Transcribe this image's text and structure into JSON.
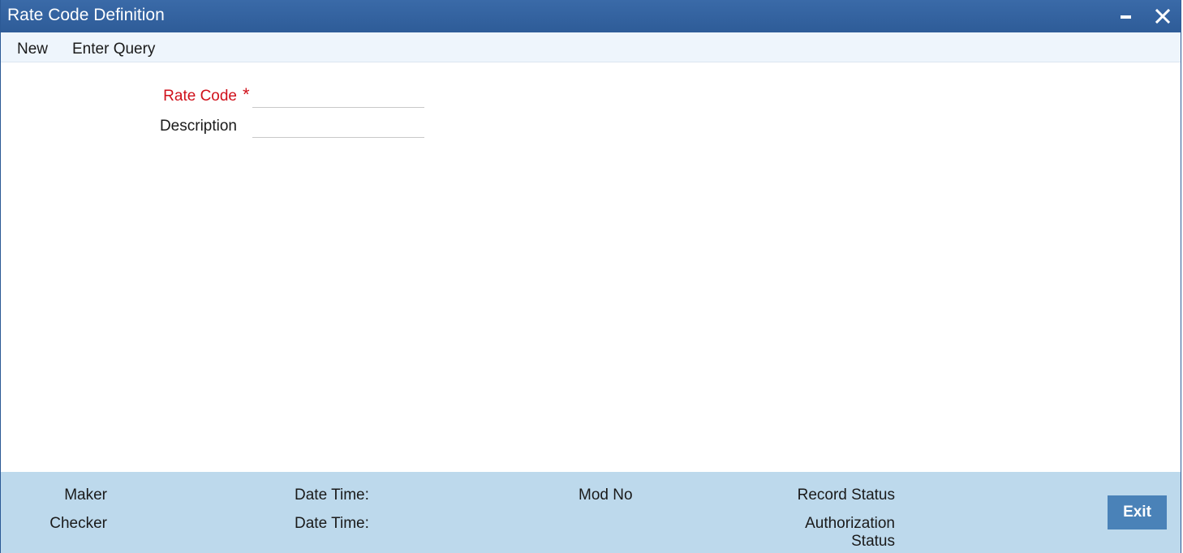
{
  "window": {
    "title": "Rate Code Definition",
    "minimize_icon": "minimize-icon",
    "close_icon": "close-icon"
  },
  "toolbar": {
    "new_label": "New",
    "enter_query_label": "Enter Query"
  },
  "form": {
    "rate_code_label": "Rate Code",
    "required_marker": "*",
    "rate_code_value": "",
    "description_label": "Description",
    "description_value": ""
  },
  "footer": {
    "maker_label": "Maker",
    "checker_label": "Checker",
    "date_time_label_1": "Date Time:",
    "date_time_label_2": "Date Time:",
    "mod_no_label": "Mod No",
    "record_status_label": "Record Status",
    "authorization_status_label": "Authorization Status",
    "exit_label": "Exit"
  },
  "colors": {
    "titlebar": "#2e5c98",
    "toolbar": "#eef5fc",
    "footer": "#bdd9ec",
    "required": "#d0111b",
    "exit_button": "#4a82b8"
  }
}
